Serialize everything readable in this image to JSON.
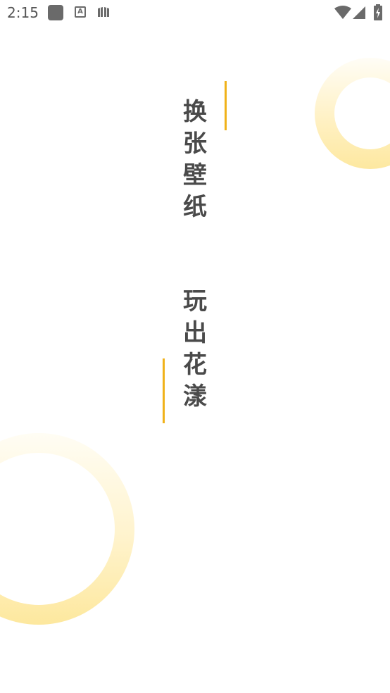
{
  "status_bar": {
    "time": "2:15",
    "notification_icons": [
      "app-icon",
      "text-a-icon",
      "book-icon"
    ],
    "system_icons": [
      "wifi-icon",
      "cell-signal-icon",
      "battery-charging-icon"
    ]
  },
  "splash": {
    "slogan_line1": [
      "换",
      "张",
      "壁",
      "纸"
    ],
    "slogan_line2": [
      "玩",
      "出",
      "花",
      "漾"
    ]
  },
  "colors": {
    "accent": "#f0b21a",
    "ring": "#fde8a0",
    "text": "#4a4a4a",
    "background": "#ffffff"
  }
}
